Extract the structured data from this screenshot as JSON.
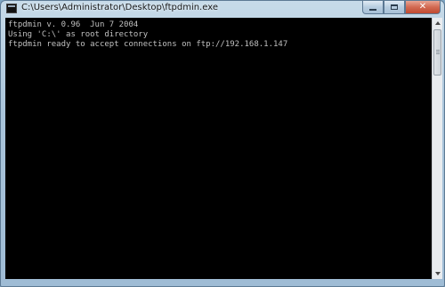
{
  "window": {
    "title": "C:\\Users\\Administrator\\Desktop\\ftpdmin.exe",
    "icon": "console-icon",
    "controls": {
      "minimize_icon": "minimize-icon",
      "maximize_icon": "maximize-icon",
      "close_label": "✕"
    }
  },
  "console": {
    "lines": [
      "ftpdmin v. 0.96  Jun 7 2004",
      "Using 'C:\\' as root directory",
      "ftpdmin ready to accept connections on ftp://192.168.1.147"
    ],
    "colors": {
      "background": "#000000",
      "text": "#c0c0c0"
    }
  }
}
